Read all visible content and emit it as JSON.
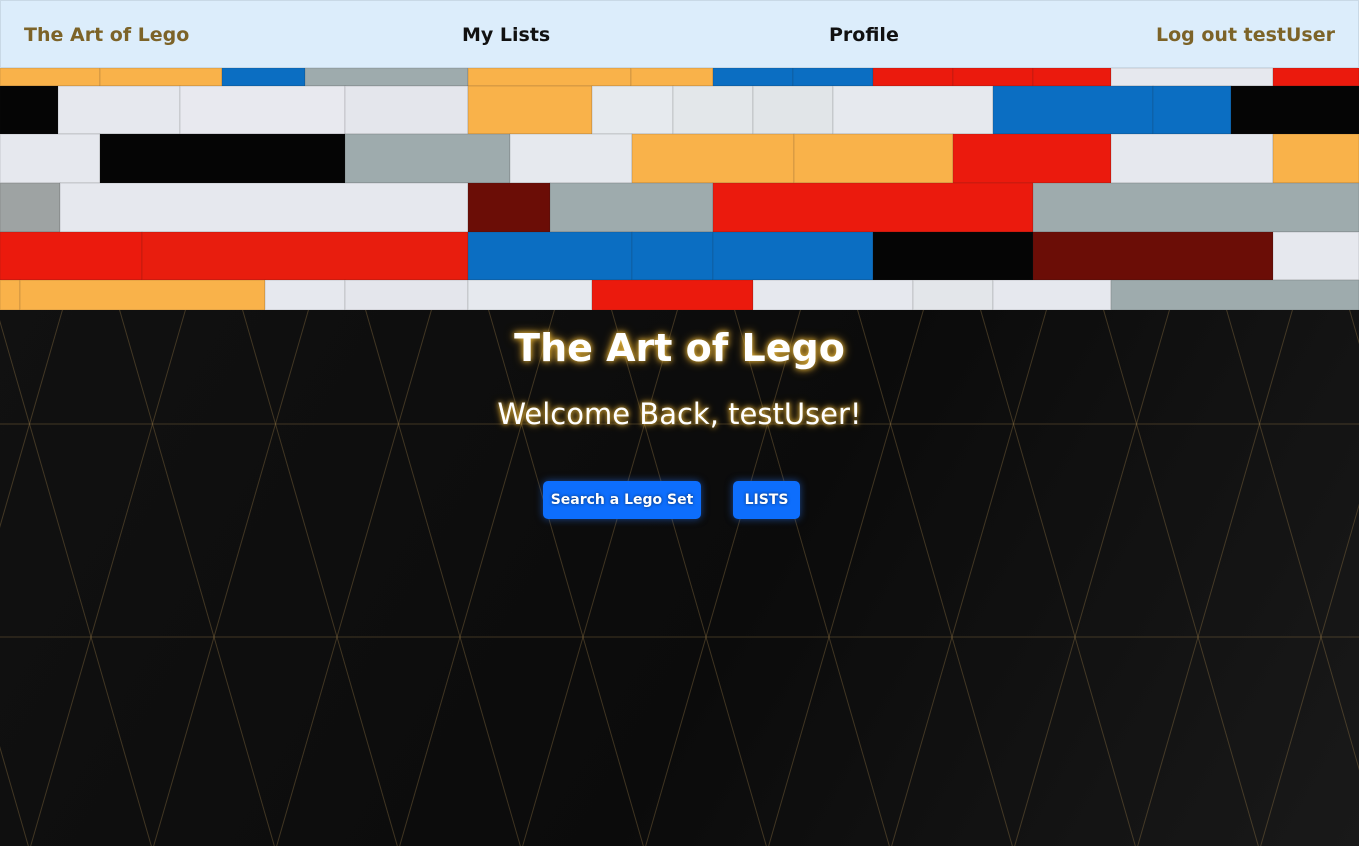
{
  "navbar": {
    "brand": "The Art of Lego",
    "my_lists": "My Lists",
    "profile": "Profile",
    "logout": "Log out testUser"
  },
  "hero": {
    "title": "The Art of Lego",
    "welcome": "Welcome Back, testUser!",
    "buttons": {
      "search": "Search a Lego Set",
      "lists": "LISTS"
    }
  },
  "colors": {
    "navbar_bg": "#dcedfb",
    "brand_gold": "#7c6328",
    "button_blue": "#0d6efd",
    "hero_bg": "#0c0c0c",
    "pattern_gold": "#a0804a"
  },
  "banner": {
    "image": "lego-brick-wall",
    "brick_colors": [
      "#f9b24a",
      "#0b6ec2",
      "#eb1a0d",
      "#e6e8ee",
      "#9eabad",
      "#050505",
      "#6b0d06"
    ]
  }
}
